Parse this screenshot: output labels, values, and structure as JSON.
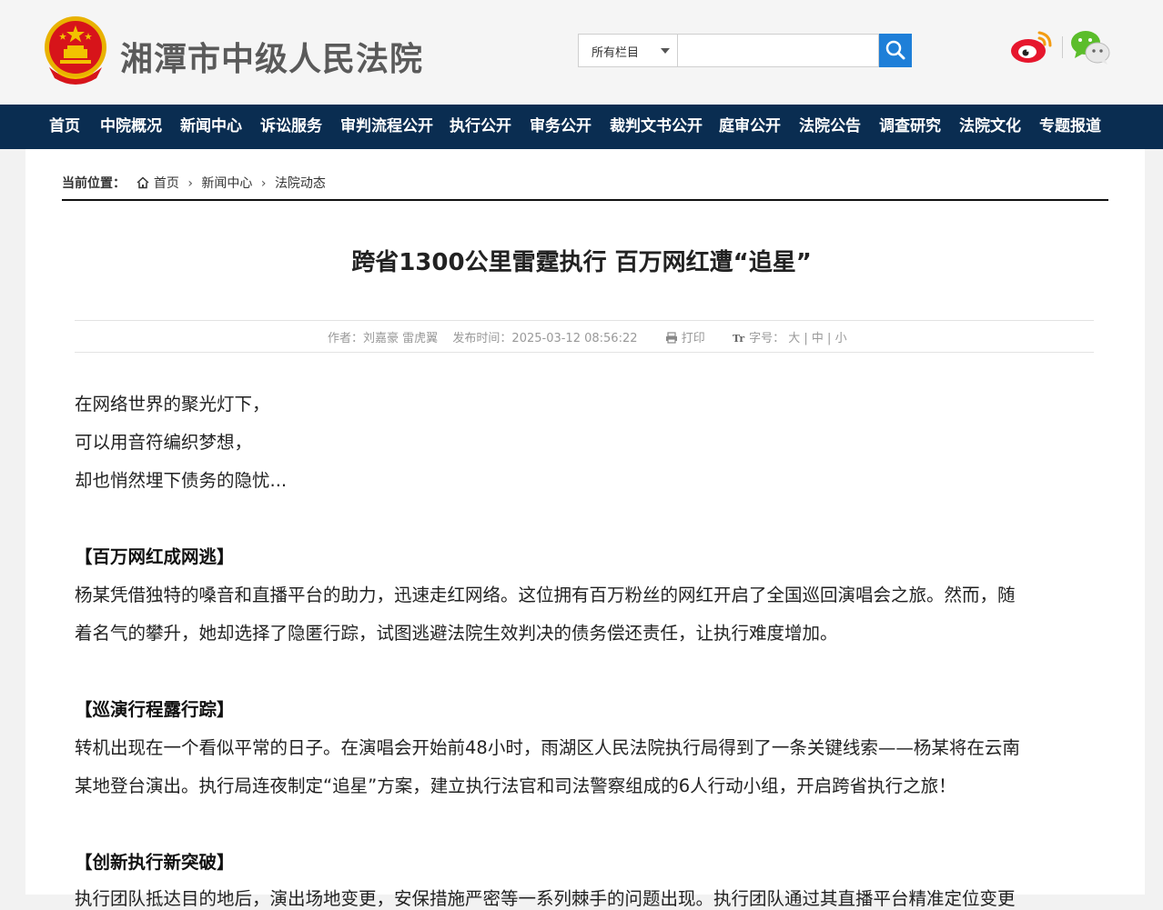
{
  "header": {
    "site_title": "湘潭市中级人民法院",
    "search": {
      "select_value": "所有栏目",
      "input_value": ""
    }
  },
  "nav": {
    "items": [
      "首页",
      "中院概况",
      "新闻中心",
      "诉讼服务",
      "审判流程公开",
      "执行公开",
      "审务公开",
      "裁判文书公开",
      "庭审公开",
      "法院公告",
      "调查研究",
      "法院文化",
      "专题报道"
    ]
  },
  "breadcrumb": {
    "label": "当前位置：",
    "items": [
      "首页",
      "新闻中心",
      "法院动态"
    ]
  },
  "article": {
    "title": "跨省1300公里雷霆执行 百万网红遭“追星”",
    "meta": {
      "author": "作者：刘嘉豪 雷虎翼",
      "published": "发布时间：2025-03-12 08:56:22",
      "print": "打印",
      "font_size_label": "字号：",
      "font_sizes": [
        "大",
        "中",
        "小"
      ]
    },
    "intro": [
      "在网络世界的聚光灯下，",
      "可以用音符编织梦想，",
      "却也悄然埋下债务的隐忧..."
    ],
    "sections": [
      {
        "heading": "【百万网红成网逃】",
        "lines": [
          "杨某凭借独特的嗓音和直播平台的助力，迅速走红网络。这位拥有百万粉丝的网红开启了全国巡回演唱会之旅。然而，随",
          "着名气的攀升，她却选择了隐匿行踪，试图逃避法院生效判决的债务偿还责任，让执行难度增加。"
        ]
      },
      {
        "heading": "【巡演行程露行踪】",
        "lines": [
          "转机出现在一个看似平常的日子。在演唱会开始前48小时，雨湖区人民法院执行局得到了一条关键线索——杨某将在云南",
          "某地登台演出。执行局连夜制定“追星”方案，建立执行法官和司法警察组成的6人行动小组，开启跨省执行之旅！"
        ]
      },
      {
        "heading": "【创新执行新突破】",
        "lines": [
          "执行团队抵达目的地后，演出场地变更，安保措施严密等一系列棘手的问题出现。执行团队通过其直播平台精准定位变更"
        ]
      }
    ]
  },
  "colors": {
    "nav_bg": "#0a2d51",
    "search_button": "#1e7fd8",
    "emblem_red": "#d7141a",
    "emblem_gold": "#f2c200"
  }
}
